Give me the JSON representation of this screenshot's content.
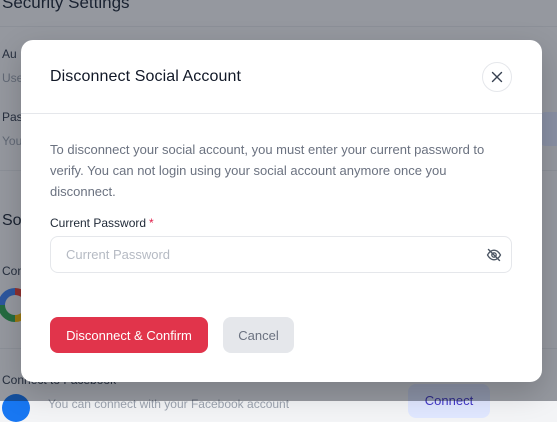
{
  "background": {
    "section_title": "Security Settings",
    "fragments": [
      "Au",
      "Use",
      "Pas",
      "You",
      "So",
      "Con",
      "Connect to Facebook",
      "You can connect with your Facebook account"
    ],
    "connect_label": "Connect"
  },
  "modal": {
    "title": "Disconnect Social Account",
    "description": "To disconnect your social account, you must enter your current password to verify. You can not login using your social account anymore once you disconnect.",
    "password_label": "Current Password",
    "required_mark": "*",
    "password_placeholder": "Current Password",
    "password_value": "",
    "confirm_label": "Disconnect & Confirm",
    "cancel_label": "Cancel"
  },
  "icons": {
    "close": "close-icon",
    "eye": "eye-off-icon"
  },
  "colors": {
    "primary": "#e1344b",
    "required": "#e11d48",
    "overlay": "rgba(17,24,39,0.42)",
    "connect_bg": "#e0e7ff"
  }
}
